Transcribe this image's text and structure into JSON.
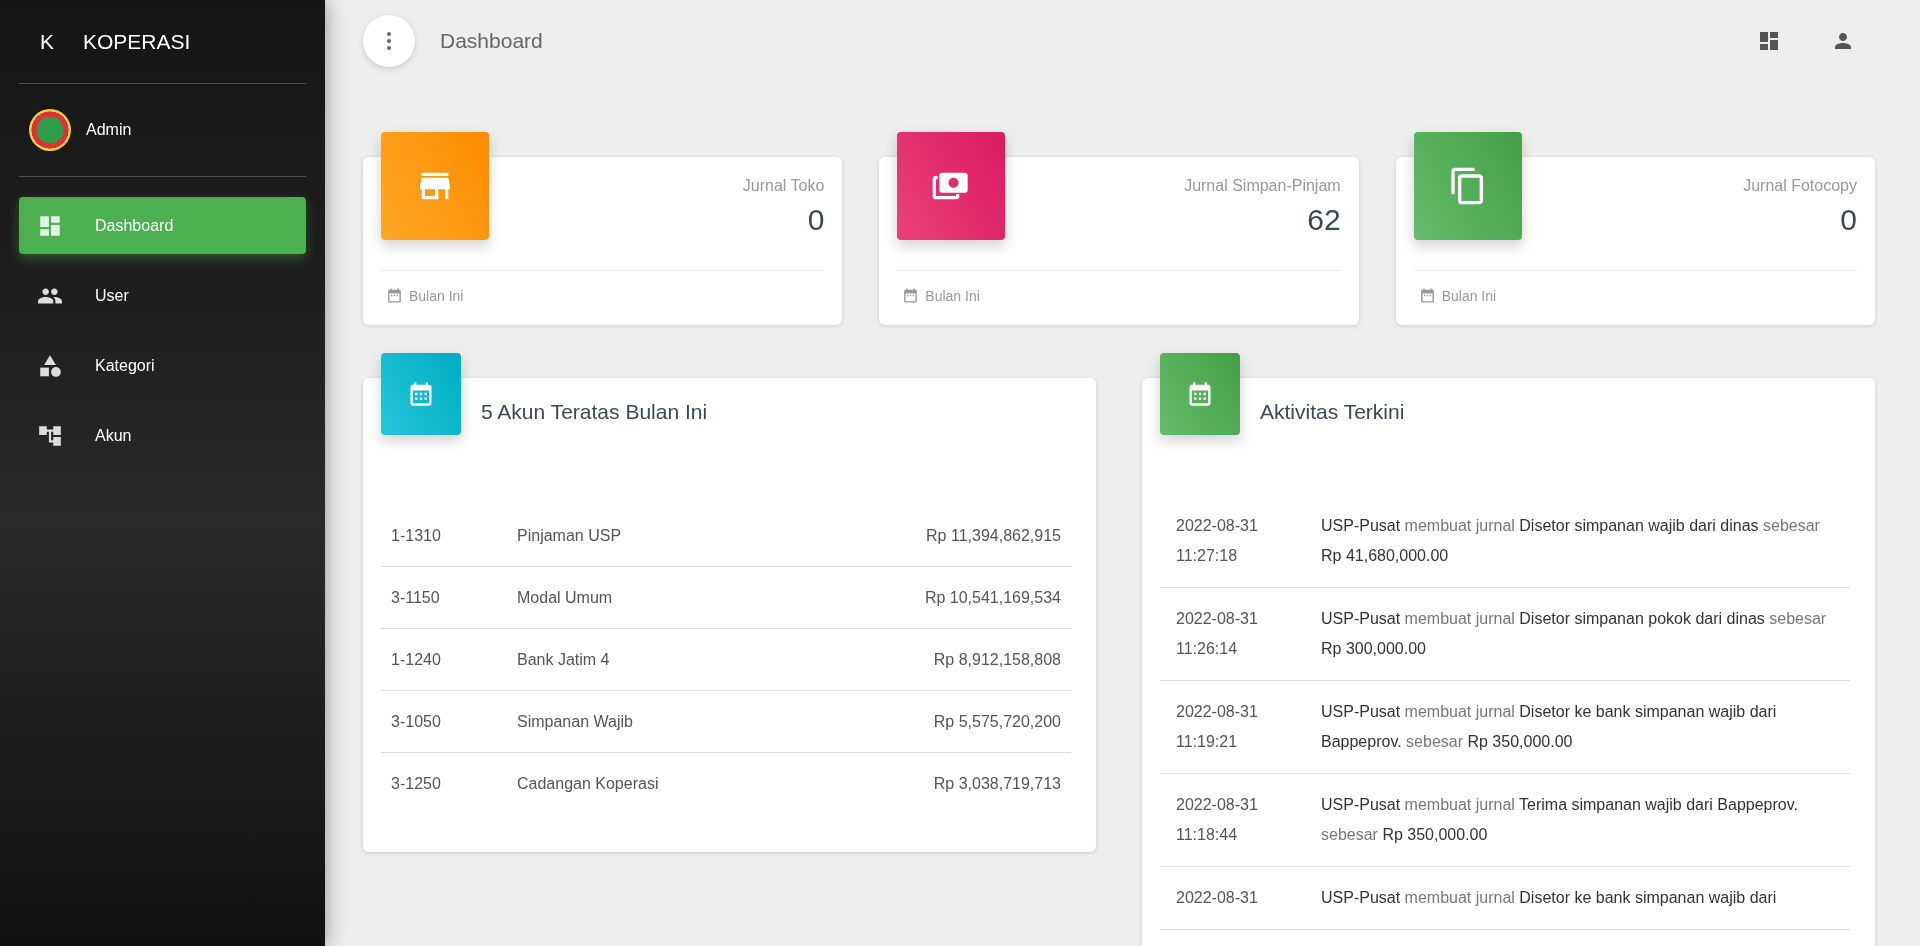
{
  "sidebar": {
    "logo_mark": "K",
    "brand": "KOPERASI",
    "user": "Admin",
    "items": [
      {
        "label": "Dashboard",
        "selected": true
      },
      {
        "label": "User",
        "selected": false
      },
      {
        "label": "Kategori",
        "selected": false
      },
      {
        "label": "Akun",
        "selected": false
      }
    ]
  },
  "header": {
    "title": "Dashboard"
  },
  "stats": [
    {
      "title": "Jurnal Toko",
      "value": "0",
      "footer": "Bulan Ini"
    },
    {
      "title": "Jurnal Simpan-Pinjam",
      "value": "62",
      "footer": "Bulan Ini"
    },
    {
      "title": "Jurnal Fotocopy",
      "value": "0",
      "footer": "Bulan Ini"
    }
  ],
  "top_accounts": {
    "title": "5 Akun Teratas Bulan Ini",
    "rows": [
      {
        "code": "1-1310",
        "name": "Pinjaman USP",
        "amount": "Rp 11,394,862,915"
      },
      {
        "code": "3-1150",
        "name": "Modal Umum",
        "amount": "Rp 10,541,169,534"
      },
      {
        "code": "1-1240",
        "name": "Bank Jatim 4",
        "amount": "Rp 8,912,158,808"
      },
      {
        "code": "3-1050",
        "name": "Simpanan Wajib",
        "amount": "Rp 5,575,720,200"
      },
      {
        "code": "3-1250",
        "name": "Cadangan Koperasi",
        "amount": "Rp 3,038,719,713"
      }
    ]
  },
  "activity": {
    "title": "Aktivitas Terkini",
    "items": [
      {
        "date": "2022-08-31",
        "time": "11:27:18",
        "text": "**USP-Pusat** membuat jurnal **Disetor simpanan wajib dari dinas** sebesar **Rp 41,680,000.00**"
      },
      {
        "date": "2022-08-31",
        "time": "11:26:14",
        "text": "**USP-Pusat** membuat jurnal **Disetor simpanan pokok dari dinas** sebesar **Rp 300,000.00**"
      },
      {
        "date": "2022-08-31",
        "time": "11:19:21",
        "text": "**USP-Pusat** membuat jurnal **Disetor ke bank simpanan wajib dari Bappeprov.** sebesar **Rp 350,000.00**"
      },
      {
        "date": "2022-08-31",
        "time": "11:18:44",
        "text": "**USP-Pusat** membuat jurnal **Terima simpanan wajib dari Bappeprov.** sebesar **Rp 350,000.00**"
      },
      {
        "date": "2022-08-31",
        "text": "**USP-Pusat** membuat jurnal **Disetor ke bank simpanan wajib dari**"
      }
    ]
  }
}
